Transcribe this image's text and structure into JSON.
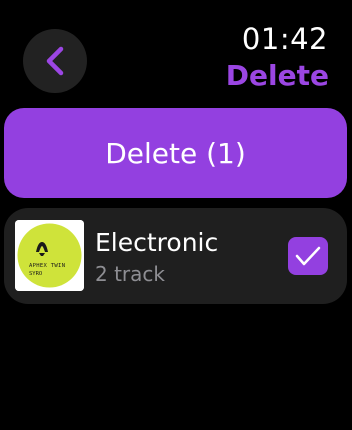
{
  "header": {
    "time": "01:42",
    "title": "Delete",
    "back_icon": "chevron-left-icon"
  },
  "delete_button": {
    "label": "Delete (1)"
  },
  "items": [
    {
      "title": "Electronic",
      "subtitle": "2 track",
      "artwork_text": [
        "APHEX TWIN",
        "SYRO"
      ],
      "checked": true,
      "check_icon": "checkmark-icon"
    }
  ],
  "colors": {
    "accent": "#9340e0",
    "accent_text": "#9b46e3",
    "background": "#000000",
    "item_background": "#1f1f1f",
    "back_button_background": "#222222",
    "artwork_disc": "#cfe33a",
    "subtitle": "#8e8e93"
  }
}
